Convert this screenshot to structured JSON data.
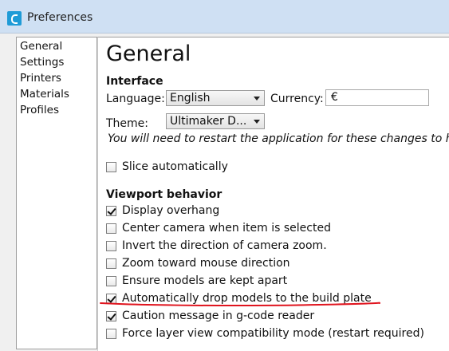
{
  "window": {
    "title": "Preferences",
    "accent_color": "#1e9bd7"
  },
  "nav": {
    "items": [
      {
        "label": "General"
      },
      {
        "label": "Settings"
      },
      {
        "label": "Printers"
      },
      {
        "label": "Materials"
      },
      {
        "label": "Profiles"
      }
    ],
    "selected": "General"
  },
  "page": {
    "title": "General"
  },
  "interface": {
    "heading": "Interface",
    "language_label": "Language:",
    "language_value": "English",
    "currency_label": "Currency:",
    "currency_value": "€",
    "theme_label": "Theme:",
    "theme_value": "Ultimaker D...",
    "restart_note": "You will need to restart the application for these changes to have"
  },
  "slicing": {
    "slice_automatically": {
      "label": "Slice automatically",
      "checked": false
    }
  },
  "viewport": {
    "heading": "Viewport behavior",
    "options": [
      {
        "label": "Display overhang",
        "checked": true
      },
      {
        "label": "Center camera when item is selected",
        "checked": false
      },
      {
        "label": "Invert the direction of camera zoom.",
        "checked": false
      },
      {
        "label": "Zoom toward mouse direction",
        "checked": false
      },
      {
        "label": "Ensure models are kept apart",
        "checked": false
      },
      {
        "label": "Automatically drop models to the build plate",
        "checked": true
      },
      {
        "label": "Caution message in g-code reader",
        "checked": true
      },
      {
        "label": "Force layer view compatibility mode (restart required)",
        "checked": false
      }
    ]
  },
  "annotation_color": "#e0141e"
}
